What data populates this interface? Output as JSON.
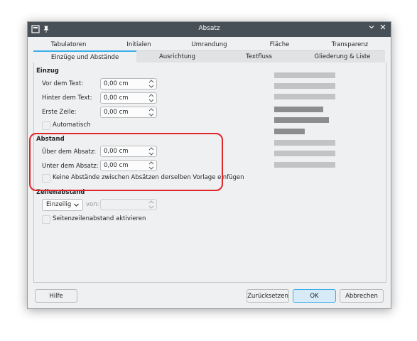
{
  "window": {
    "title": "Absatz"
  },
  "tabs_row1": [
    "Tabulatoren",
    "Initialen",
    "Umrandung",
    "Fläche",
    "Transparenz"
  ],
  "tabs_row2": [
    "Einzüge und Abstände",
    "Ausrichtung",
    "Textfluss",
    "Gliederung & Liste"
  ],
  "active_tab": "Einzüge und Abstände",
  "einzug": {
    "title": "Einzug",
    "vor_label": "Vor dem Text:",
    "vor_value": "0,00 cm",
    "hinter_label": "Hinter dem Text:",
    "hinter_value": "0,00 cm",
    "erste_label": "Erste Zeile:",
    "erste_value": "0,00 cm",
    "automatisch_label": "Automatisch"
  },
  "abstand": {
    "title": "Abstand",
    "ueber_label": "Über dem Absatz:",
    "ueber_value": "0,00 cm",
    "unter_label": "Unter dem Absatz:",
    "unter_value": "0,00 cm",
    "keine_label": "Keine Abstände zwischen Absätzen derselben Vorlage einfügen"
  },
  "zeilenabstand": {
    "title": "Zeilenabstand",
    "select_value": "Einzeilig",
    "von_label": "von:",
    "von_value": "",
    "seitenzeilen_label": "Seitenzeilenabstand aktivieren"
  },
  "buttons": {
    "hilfe": "Hilfe",
    "zuruecksetzen": "Zurücksetzen",
    "ok": "OK",
    "abbrechen": "Abbrechen"
  },
  "colors": {
    "accent": "#3daee9",
    "highlight": "#e0252b",
    "titlebar": "#475057"
  }
}
